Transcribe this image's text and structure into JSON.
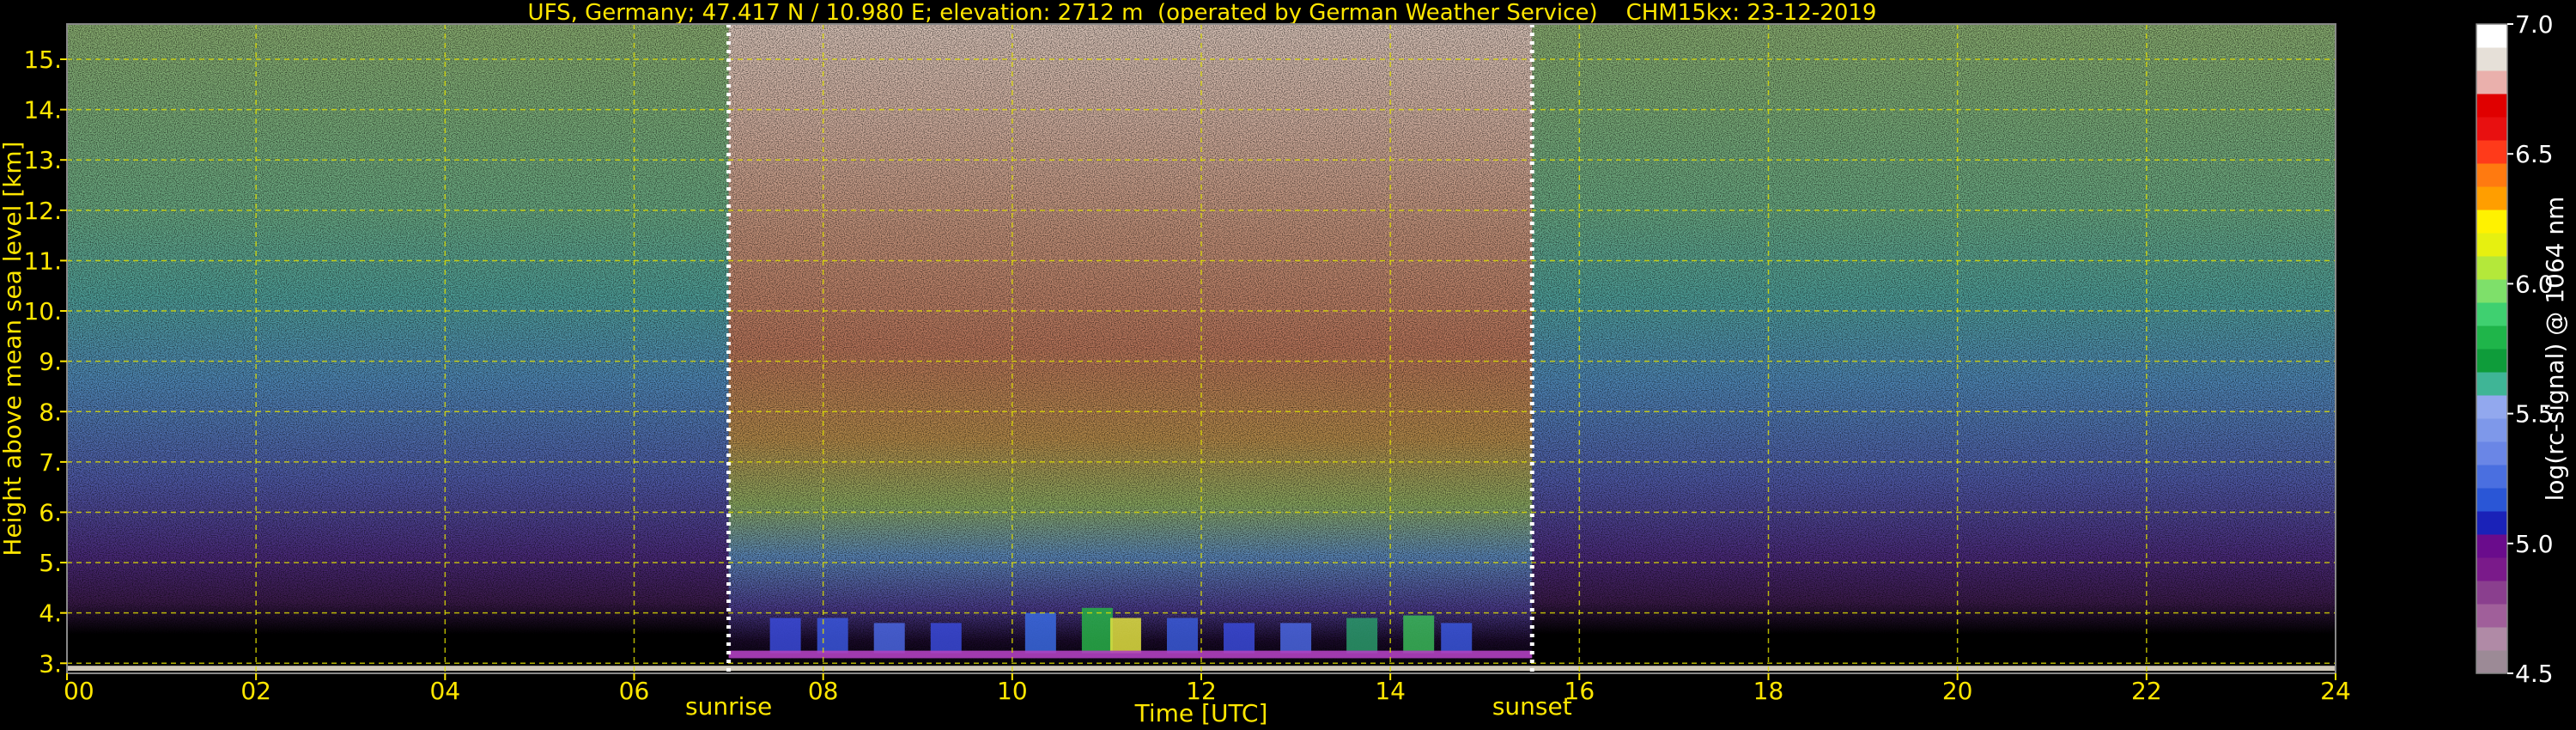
{
  "chart_data": {
    "type": "heatmap",
    "title": "UFS, Germany; 47.417 N / 10.980 E; elevation: 2712 m  (operated by German Weather Service)    CHM15kx: 23-12-2019",
    "xlabel": "Time [UTC]",
    "ylabel": "Height above mean sea level [km]",
    "xlim": [
      0,
      24
    ],
    "ylim": [
      2.8,
      15.7
    ],
    "x_ticks": [
      "00",
      "02",
      "04",
      "06",
      "08",
      "10",
      "12",
      "14",
      "16",
      "18",
      "20",
      "22",
      "24"
    ],
    "x_tick_values": [
      0,
      2,
      4,
      6,
      8,
      10,
      12,
      14,
      16,
      18,
      20,
      22,
      24
    ],
    "y_ticks": [
      "3.",
      "4.",
      "5.",
      "6.",
      "7.",
      "8.",
      "9.",
      "10.",
      "11.",
      "12.",
      "13.",
      "14.",
      "15."
    ],
    "y_tick_values": [
      3,
      4,
      5,
      6,
      7,
      8,
      9,
      10,
      11,
      12,
      13,
      14,
      15
    ],
    "grid": true,
    "annotations": [
      {
        "text": "sunrise",
        "x": 7.0
      },
      {
        "text": "sunset",
        "x": 15.5
      }
    ],
    "colorbar": {
      "label": "log(rc-signal) @ 1064 nm",
      "range": [
        4.5,
        7.0
      ],
      "ticks": [
        "4.5",
        "5.0",
        "5.5",
        "6.0",
        "6.5",
        "7.0"
      ],
      "tick_values": [
        4.5,
        5.0,
        5.5,
        6.0,
        6.5,
        7.0
      ],
      "colors": [
        "#9c8a96",
        "#b08aa6",
        "#a05f9a",
        "#8a3f8e",
        "#7a1a8a",
        "#6a0c8c",
        "#1a22b8",
        "#2a56d6",
        "#4a6fe0",
        "#6a86e6",
        "#7e98ea",
        "#92a8ee",
        "#3fb596",
        "#0e9c3a",
        "#1fb54a",
        "#3fd070",
        "#7ee06a",
        "#b4e83a",
        "#e6f010",
        "#fff200",
        "#ff9e00",
        "#ff7a10",
        "#ff3a1a",
        "#e81010",
        "#e00000",
        "#eab0ac",
        "#e6e0d8",
        "#ffffff"
      ]
    },
    "colors": {
      "text": "#ffe600",
      "grid": "#e0e000",
      "background": "#000000"
    }
  }
}
